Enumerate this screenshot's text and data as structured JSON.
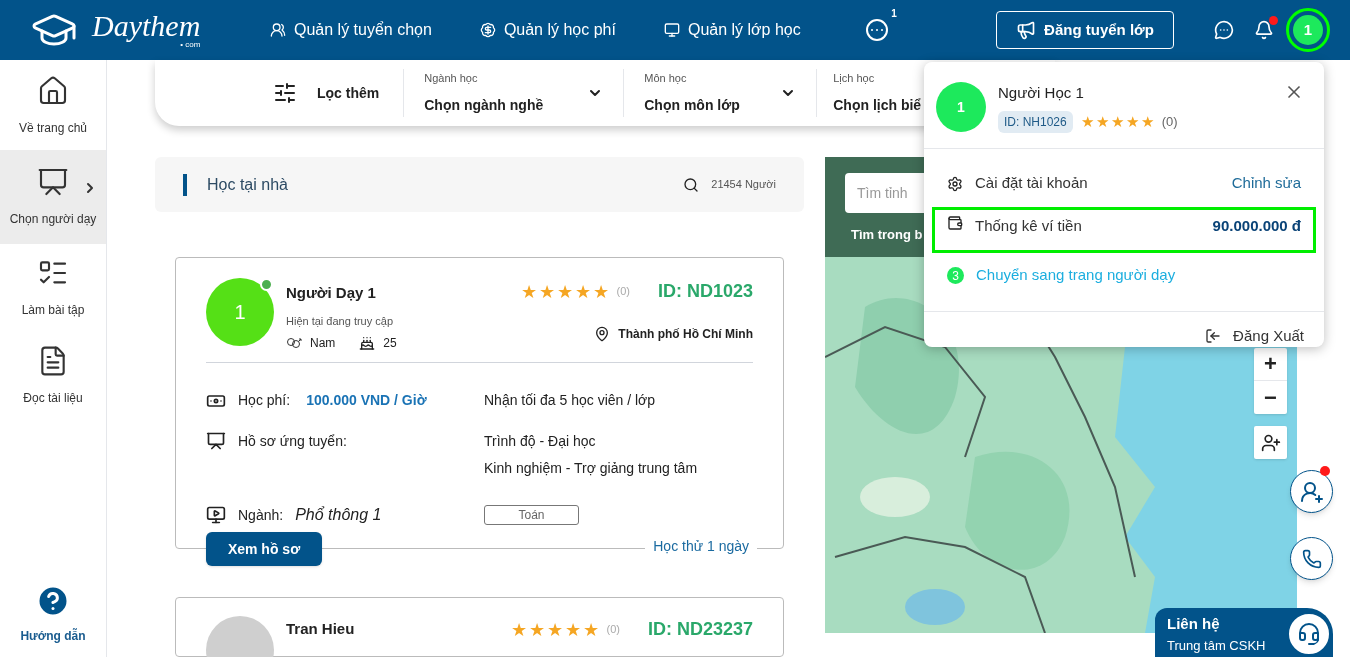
{
  "header": {
    "logo": {
      "name": "Daythem",
      "suffix": "• com"
    },
    "nav": [
      {
        "kind": "users",
        "label": "Quản lý tuyển chọn"
      },
      {
        "kind": "fee",
        "label": "Quản lý học phí"
      },
      {
        "kind": "class",
        "label": "Quản lý lớp học"
      }
    ],
    "more_badge": "1",
    "post_button": "Đăng tuyển lớp",
    "notification_unread": true,
    "avatar": "1",
    "avatar_highlighted": true
  },
  "sidebar": {
    "items": [
      {
        "kind": "home",
        "label": "Về trang chủ",
        "selected": false
      },
      {
        "kind": "teacher",
        "label": "Chọn người dạy",
        "selected": true
      },
      {
        "kind": "quiz",
        "label": "Làm bài tập",
        "selected": false
      },
      {
        "kind": "pdf",
        "label": "Đọc tài liệu",
        "selected": false
      }
    ],
    "help": "Hướng dẫn"
  },
  "filter": {
    "label": "Lọc thêm",
    "fields": [
      {
        "label": "Ngành học",
        "value": "Chọn ngành nghề"
      },
      {
        "label": "Môn học",
        "value": "Chọn môn lớp"
      },
      {
        "label": "Lịch học",
        "value": "Chọn lịch biể"
      }
    ]
  },
  "list_header": {
    "title": "Học tại nhà",
    "count": "21454 Người"
  },
  "tutors": [
    {
      "avatar": "1",
      "online": true,
      "name": "Người Dạy 1",
      "status": "Hiện tại đang truy cập",
      "gender": "Nam",
      "age": "25",
      "stars": 5,
      "reviews": "(0)",
      "id": "ID: ND1023",
      "location": "Thành phố Hồ Chí Minh",
      "fee_label": "Học phí:",
      "fee": "100.000 VND / Giờ",
      "capacity": "Nhận tối đa 5 học viên / lớp",
      "profile_label": "Hồ sơ ứng tuyển:",
      "qualifications": [
        "Trình độ - Đại học",
        "Kinh nghiệm - Trợ giảng trung tâm"
      ],
      "major_label": "Ngành:",
      "major": "Phổ thông 1",
      "subject": "Toán",
      "button": "Xem hồ sơ",
      "trial": "Học thử 1 ngày"
    },
    {
      "name": "Tran Hieu",
      "stars": 5,
      "reviews": "(0)",
      "id": "ID: ND23237"
    }
  ],
  "map": {
    "search_placeholder": "Tìm tỉnh",
    "area_label": "Tìm trong b",
    "zoom_in": "+",
    "zoom_out": "−"
  },
  "account_menu": {
    "avatar": "1",
    "name": "Người Học 1",
    "id": "ID: NH1026",
    "stars": 5,
    "reviews": "(0)",
    "items": [
      {
        "kind": "settings",
        "label": "Cài đặt tài khoản",
        "action": "Chỉnh sửa",
        "highlighted": false
      },
      {
        "kind": "wallet",
        "label": "Thống kê ví tiền",
        "value": "90.000.000 đ",
        "highlighted": true
      },
      {
        "kind": "switch",
        "badge": "3",
        "label": "Chuyển sang trang người dạy",
        "highlighted": false
      }
    ],
    "logout": "Đăng Xuất"
  },
  "contact": {
    "title": "Liên hệ",
    "subtitle": "Trung tâm CSKH",
    "chat_unread": true
  }
}
